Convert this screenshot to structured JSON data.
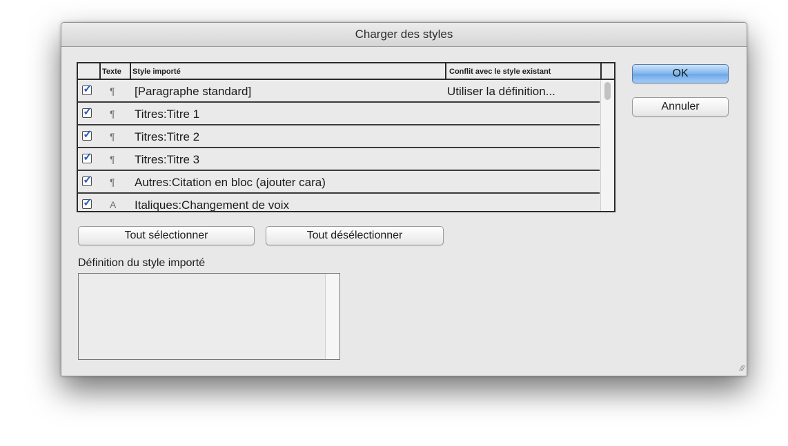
{
  "dialog": {
    "title": "Charger des styles"
  },
  "table": {
    "headers": {
      "type": "Texte",
      "style": "Style importé",
      "conflict": "Conflit avec le style existant"
    },
    "rows": [
      {
        "checked": true,
        "type_icon": "¶",
        "name": "[Paragraphe standard]",
        "conflict": "Utiliser la définition..."
      },
      {
        "checked": true,
        "type_icon": "¶",
        "name": "Titres:Titre 1",
        "conflict": ""
      },
      {
        "checked": true,
        "type_icon": "¶",
        "name": "Titres:Titre 2",
        "conflict": ""
      },
      {
        "checked": true,
        "type_icon": "¶",
        "name": "Titres:Titre 3",
        "conflict": ""
      },
      {
        "checked": true,
        "type_icon": "¶",
        "name": "Autres:Citation en bloc (ajouter cara)",
        "conflict": ""
      },
      {
        "checked": true,
        "type_icon": "A",
        "name": "Italiques:Changement de voix",
        "conflict": ""
      }
    ]
  },
  "buttons": {
    "ok": "OK",
    "cancel": "Annuler",
    "select_all": "Tout sélectionner",
    "deselect_all": "Tout désélectionner"
  },
  "definition": {
    "label": "Définition du style importé",
    "content": ""
  },
  "icons": {
    "checkbox_checked": "✓",
    "paragraph_style": "pilcrow-icon",
    "character_style": "character-style-icon",
    "resize_grip": "resize-grip-icon"
  },
  "colors": {
    "accent": "#6aa6e8",
    "check": "#2a5ec2"
  }
}
